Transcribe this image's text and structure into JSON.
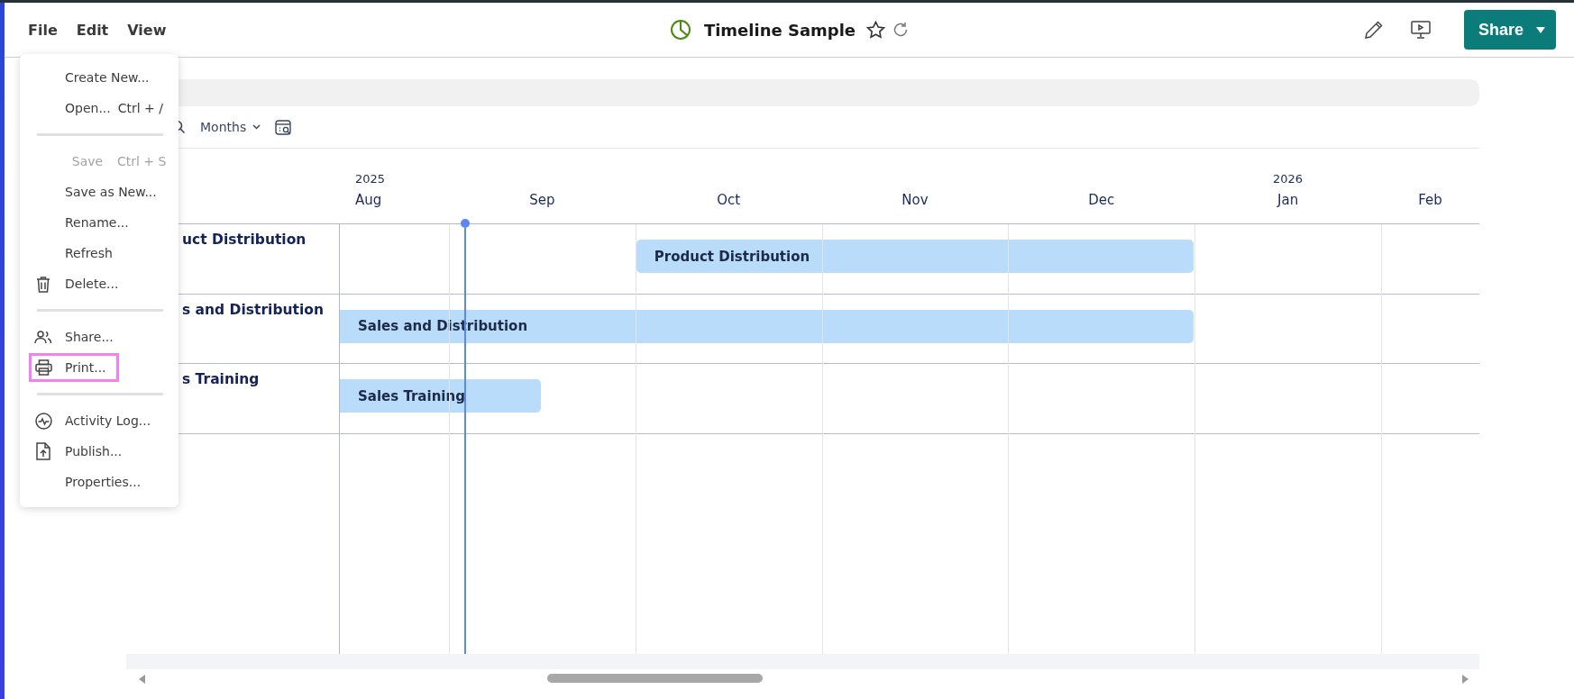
{
  "menubar": [
    {
      "label": "File"
    },
    {
      "label": "Edit"
    },
    {
      "label": "View"
    }
  ],
  "title": "Timeline Sample",
  "share_button": "Share",
  "file_menu": [
    {
      "kind": "item",
      "label": "Create New...",
      "disabled": false,
      "highlighted": false
    },
    {
      "kind": "item",
      "label": "Open...",
      "shortcut": "Ctrl + /",
      "disabled": false,
      "highlighted": false
    },
    {
      "kind": "divider"
    },
    {
      "kind": "item",
      "label": "Save",
      "shortcut": "Ctrl + S",
      "disabled": true,
      "highlighted": false
    },
    {
      "kind": "item",
      "label": "Save as New...",
      "disabled": false,
      "highlighted": false
    },
    {
      "kind": "item",
      "label": "Rename...",
      "disabled": false,
      "highlighted": false
    },
    {
      "kind": "item",
      "label": "Refresh",
      "disabled": false,
      "highlighted": false
    },
    {
      "kind": "item",
      "label": "Delete...",
      "disabled": false,
      "highlighted": false
    },
    {
      "kind": "divider"
    },
    {
      "kind": "item",
      "label": "Share...",
      "disabled": false,
      "highlighted": false
    },
    {
      "kind": "item",
      "label": "Print...",
      "disabled": false,
      "highlighted": true
    },
    {
      "kind": "divider"
    },
    {
      "kind": "item",
      "label": "Activity Log...",
      "disabled": false,
      "highlighted": false
    },
    {
      "kind": "item",
      "label": "Publish...",
      "disabled": false,
      "highlighted": false
    },
    {
      "kind": "item",
      "label": "Properties...",
      "disabled": false,
      "highlighted": false
    }
  ],
  "toolbar": {
    "zoom_unit": "Months"
  },
  "timeline": {
    "months": [
      {
        "label": "Aug",
        "year": "2025"
      },
      {
        "label": "Sep"
      },
      {
        "label": "Oct"
      },
      {
        "label": "Nov"
      },
      {
        "label": "Dec"
      },
      {
        "label": "Jan",
        "year": "2026"
      },
      {
        "label": "Feb"
      }
    ],
    "tasks": [
      {
        "label": "uct Distribution",
        "bar_label": "Product Distribution"
      },
      {
        "label": "s and Distribution",
        "bar_label": "Sales and Distribution"
      },
      {
        "label": "s Training",
        "bar_label": "Sales Training"
      }
    ]
  }
}
